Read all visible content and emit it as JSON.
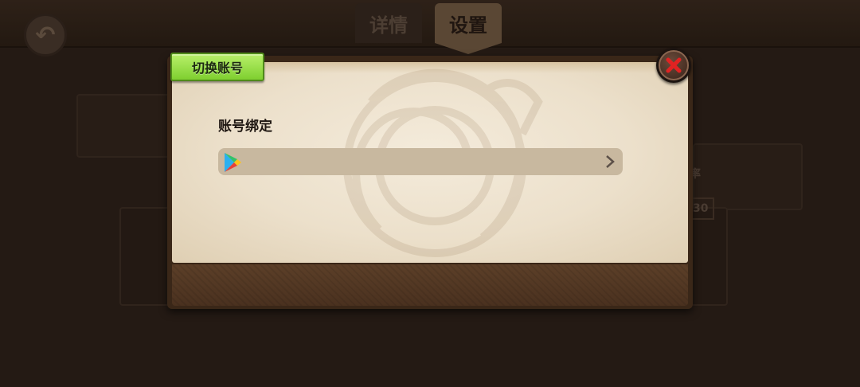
{
  "background": {
    "tabs": [
      "详情",
      "设置"
    ],
    "fragments": [
      "率",
      "30"
    ]
  },
  "dialog": {
    "title": "切换账号",
    "section_label": "账号绑定",
    "bind_row": {
      "provider_icon": "google-play-icon",
      "action_icon": "chevron-right-icon"
    },
    "close_icon": "close-icon"
  },
  "colors": {
    "title_tag": "#8fdc3c",
    "close_x": "#d62020",
    "parchment": "#efe4d0",
    "bind_row": "#c8b89f",
    "wood": "#54392a"
  }
}
